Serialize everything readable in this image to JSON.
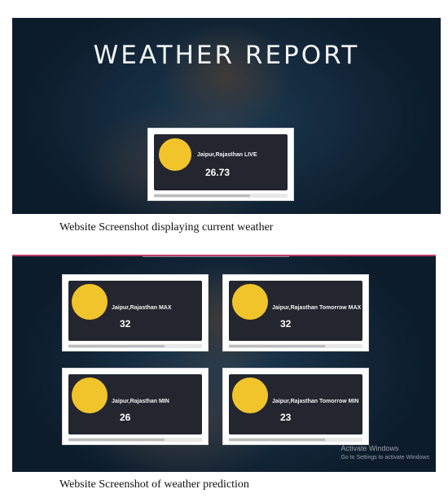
{
  "screenshot1": {
    "title": "WEATHER REPORT",
    "card": {
      "label": "Jaipur,Rajasthan LIVE",
      "value": "26.73",
      "icon": "sun-icon"
    }
  },
  "caption1": "Website Screenshot displaying current weather",
  "screenshot2": {
    "cards": [
      {
        "label": "Jaipur,Rajasthan MAX",
        "value": "32",
        "icon": "sun-icon"
      },
      {
        "label": "Jaipur,Rajasthan Tomorrow MAX",
        "value": "32",
        "icon": "sun-icon"
      },
      {
        "label": "Jaipur,Rajasthan MIN",
        "value": "26",
        "icon": "sun-icon"
      },
      {
        "label": "Jaipur,Rajasthan Tomorrow MIN",
        "value": "23",
        "icon": "sun-icon"
      }
    ],
    "watermark": {
      "line1": "Activate Windows",
      "line2": "Go to Settings to activate Windows"
    }
  },
  "caption2": "Website Screenshot of weather prediction",
  "colors": {
    "sun": "#f2c42b",
    "panel": "#23262f",
    "accent_line": "#c23b6b"
  }
}
